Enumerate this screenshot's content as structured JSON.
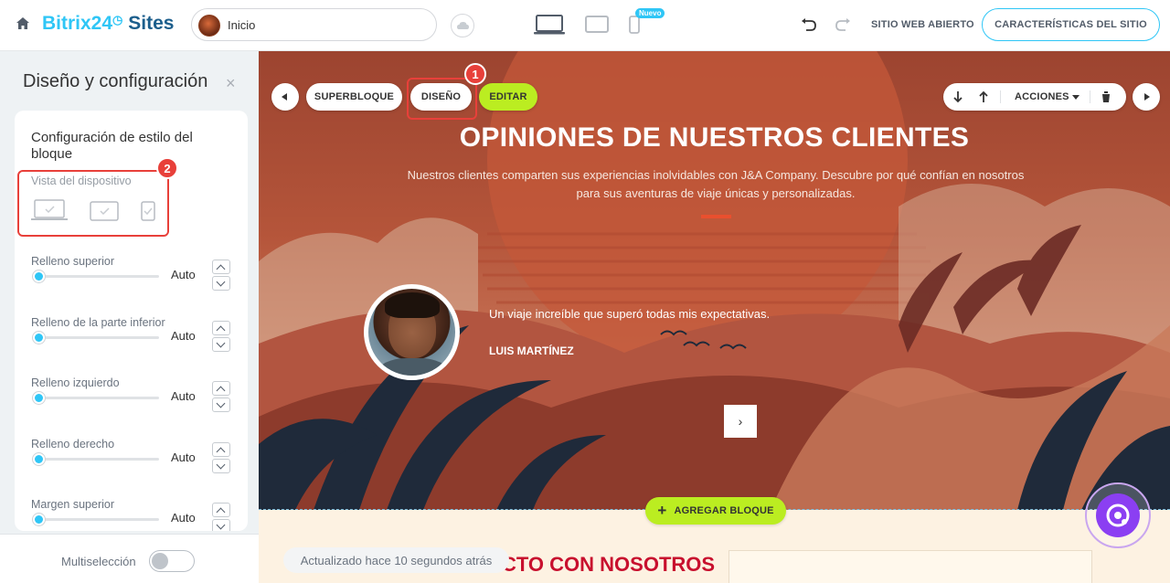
{
  "topbar": {
    "logo_bitrix": "Bitrix24",
    "logo_sites": "Sites",
    "page_name": "Inicio",
    "new_badge": "Nuevo",
    "open_site": "SITIO WEB ABIERTO",
    "site_settings": "CARACTERÍSTICAS DEL SITIO"
  },
  "panel": {
    "title": "Diseño y configuración",
    "close": "×",
    "card_title": "Configuración de estilo del bloque",
    "device_view_label": "Vista del dispositivo",
    "fields": [
      {
        "label": "Relleno superior",
        "value": "Auto"
      },
      {
        "label": "Relleno de la parte inferior",
        "value": "Auto"
      },
      {
        "label": "Relleno izquierdo",
        "value": "Auto"
      },
      {
        "label": "Relleno derecho",
        "value": "Auto"
      },
      {
        "label": "Margen superior",
        "value": "Auto"
      }
    ],
    "multiselect_label": "Multiselección"
  },
  "toolbar": {
    "superblock": "SUPERBLOQUE",
    "design": "DISEÑO",
    "edit": "EDITAR",
    "actions": "ACCIONES"
  },
  "hero": {
    "title": "OPINIONES DE NUESTROS CLIENTES",
    "subtitle": "Nuestros clientes comparten sus experiencias inolvidables con J&A Company. Descubre por qué confían en nosotros para sus aventuras de viaje únicas y personalizadas.",
    "quote": "Un viaje increíble que superó todas mis expectativas.",
    "author": "LUIS MARTÍNEZ",
    "next": "›"
  },
  "add_block": "AGREGAR BLOQUE",
  "contact_title": "CTO CON NOSOTROS",
  "updated": "Actualizado hace 10 segundos atrás",
  "annotations": [
    "1",
    "2"
  ],
  "colors": {
    "accent": "#2fc6f6",
    "lime": "#bbed21",
    "highlight": "#e8403a",
    "assistant": "#8b3ff2"
  }
}
